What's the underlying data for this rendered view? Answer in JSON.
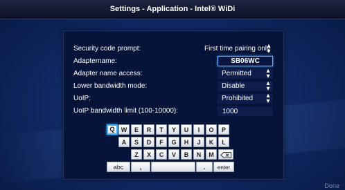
{
  "window": {
    "title": "Settings - Application - Intel® WiDi"
  },
  "settings": {
    "security": {
      "label": "Security code prompt:",
      "value": "First time pairing only"
    },
    "adaptername": {
      "label": "Adaptername:",
      "value": "SB06WC"
    },
    "name_access": {
      "label": "Adapter name access:",
      "value": "Permitted"
    },
    "bandwidth_mode": {
      "label": "Lower bandwidth mode:",
      "value": "Disable"
    },
    "uoip": {
      "label": "UoIP:",
      "value": "Prohibited"
    },
    "uoip_limit": {
      "label": "UoIP bandwidth limit (100-10000):",
      "value": "1000"
    }
  },
  "keyboard": {
    "row1": [
      "Q",
      "W",
      "E",
      "R",
      "T",
      "Y",
      "U",
      "I",
      "O",
      "P"
    ],
    "row2": [
      "A",
      "S",
      "D",
      "F",
      "G",
      "H",
      "J",
      "K",
      "L"
    ],
    "row3": [
      "Z",
      "X",
      "C",
      "V",
      "B",
      "N",
      "M"
    ],
    "backspace_icon": "backspace-icon",
    "abc_label": "abc",
    "comma_label": ",",
    "space_label": "",
    "period_label": ".",
    "enter_label": "enter",
    "selected_key": "Q"
  },
  "footer": {
    "done_label": "Done"
  },
  "colors": {
    "focus": "#4aa8ff",
    "panel": "#07143a",
    "background": "#102a66"
  }
}
